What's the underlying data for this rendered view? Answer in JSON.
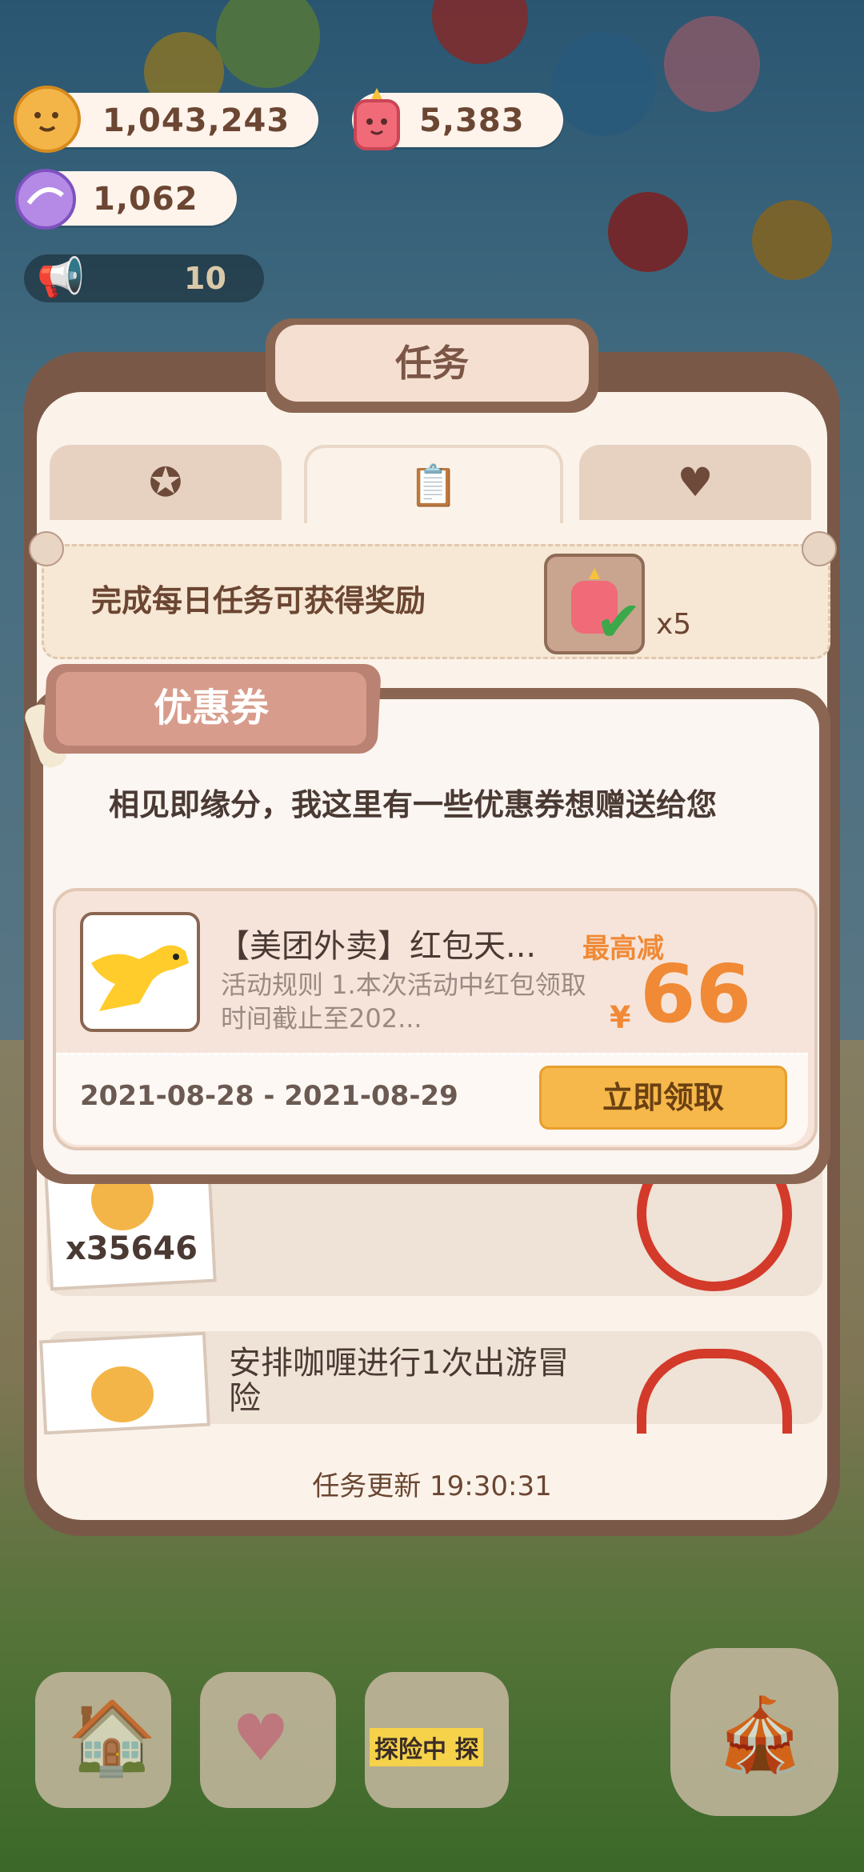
{
  "currency": {
    "cookies": "1,043,243",
    "candles": "5,383",
    "gems": "1,062",
    "energy": "10"
  },
  "task_panel": {
    "title": "任务",
    "tabs": [
      {
        "icon": "badge-icon",
        "active": false
      },
      {
        "icon": "clipboard-icon",
        "active": true
      },
      {
        "icon": "bottle-heart-icon",
        "active": false
      }
    ],
    "daily_reward_text": "完成每日任务可获得奖励",
    "daily_reward_count": "x5",
    "task1_count": "x35646",
    "task2_title": "安排咖喱进行1次出游冒险",
    "refresh_text": "任务更新 19:30:31"
  },
  "coupon_modal": {
    "ribbon_title": "优惠券",
    "message": "相见即缘分，我这里有一些优惠券想赠送给您",
    "coupon": {
      "title": "【美团外卖】红包天...",
      "description": "活动规则 1.本次活动中红包领取时间截止至202...",
      "max_label": "最高减",
      "currency_symbol": "¥",
      "amount": "66",
      "date_range": "2021-08-28 - 2021-08-29",
      "claim_label": "立即领取"
    }
  },
  "bottom_bar": {
    "adventure_label": "探险中 探"
  },
  "colors": {
    "panel_brown": "#7a5848",
    "accent_orange": "#f08a36",
    "button_yellow": "#f6b84a",
    "stamp_red": "#d33a2a"
  }
}
